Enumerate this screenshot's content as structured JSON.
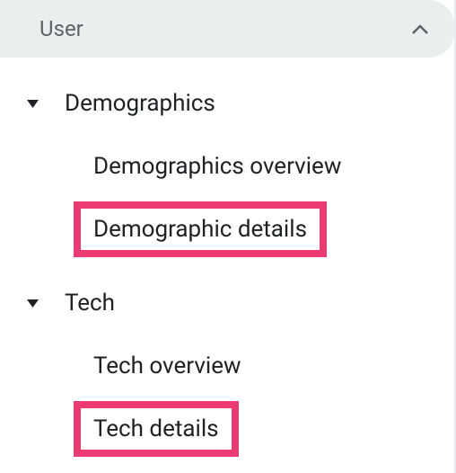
{
  "section": {
    "title": "User"
  },
  "tree": {
    "items": [
      {
        "label": "Demographics",
        "children": [
          {
            "label": "Demographics overview"
          },
          {
            "label": "Demographic details"
          }
        ]
      },
      {
        "label": "Tech",
        "children": [
          {
            "label": "Tech overview"
          },
          {
            "label": "Tech details"
          }
        ]
      }
    ]
  }
}
